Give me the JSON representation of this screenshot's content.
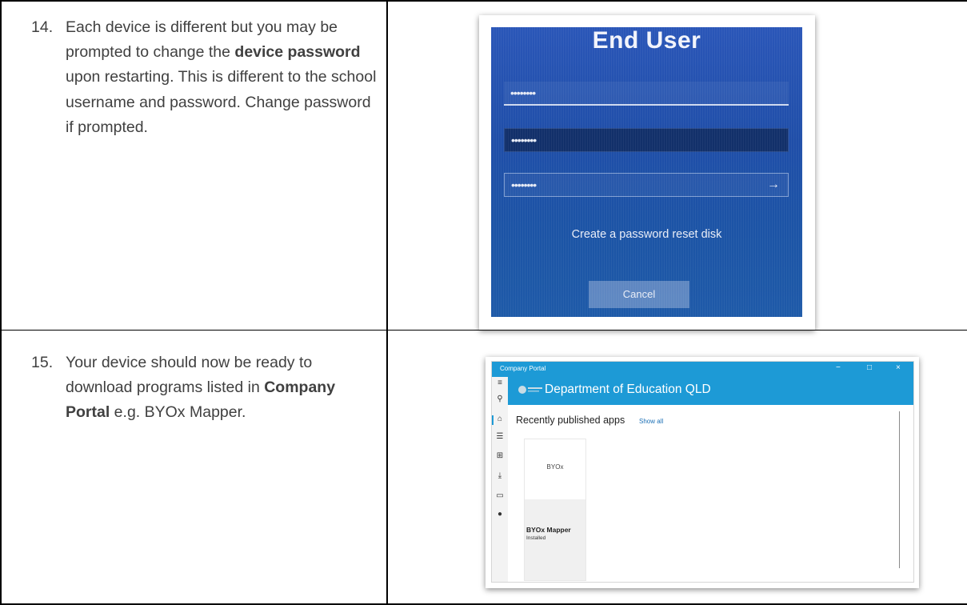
{
  "steps": [
    {
      "number": "14.",
      "text_before": "Each device is different but you may be prompted to change the ",
      "bold": "device password",
      "text_after": " upon restarting. This is different to the school username and password. Change password if prompted."
    },
    {
      "number": "15.",
      "text_before": "Your device should now be ready to download programs listed in ",
      "bold": "Company Portal",
      "text_after": " e.g. BYOx Mapper."
    }
  ],
  "login_screen": {
    "title": "End User",
    "password_mask_1": "••••••••",
    "password_mask_2": "••••••••",
    "password_mask_3": "••••••••",
    "submit_glyph": "→",
    "reset_link": "Create a password reset disk",
    "cancel_label": "Cancel"
  },
  "company_portal": {
    "window_title": "Company Portal",
    "window_controls": {
      "minimize": "−",
      "maximize": "□",
      "close": "×"
    },
    "org_name": "Department of Education QLD",
    "section_title": "Recently published apps",
    "show_all": "Show all",
    "nav_icons": [
      "menu-icon",
      "search-icon",
      "home-icon",
      "list-icon",
      "apps-grid-icon",
      "download-icon",
      "device-icon",
      "help-icon"
    ],
    "app": {
      "thumb_label": "BYOx",
      "name": "BYOx Mapper",
      "status": "Installed"
    }
  }
}
